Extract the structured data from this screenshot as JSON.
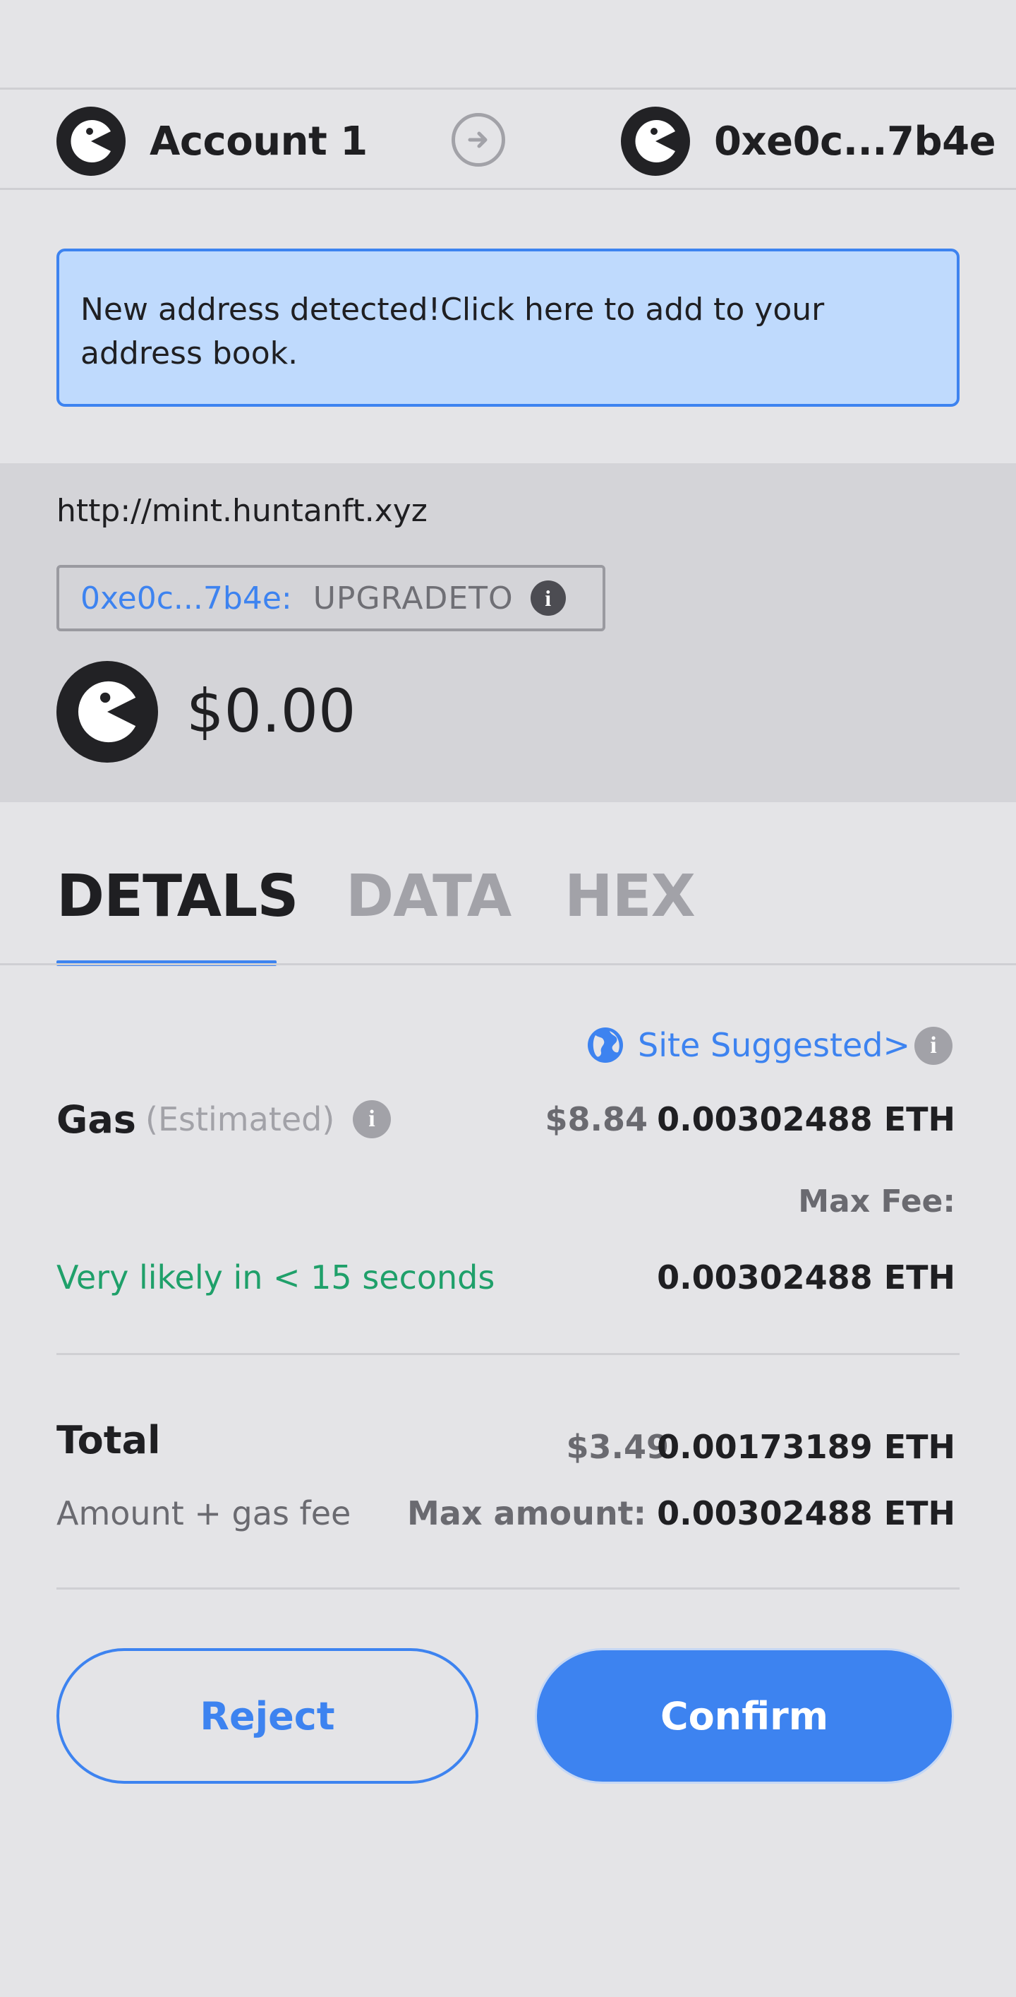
{
  "header": {
    "from_account": "Account 1",
    "to_account": "0xe0c...7b4e"
  },
  "banner": {
    "text": "New address detected!Click here to add to your address book."
  },
  "site": {
    "origin": "http://mint.huntanft.xyz",
    "method_address": "0xe0c...7b4e:",
    "method_name": "UPGRADETO",
    "amount": "$0.00"
  },
  "tabs": [
    {
      "label": "DETALS",
      "active": true
    },
    {
      "label": "DATA",
      "active": false
    },
    {
      "label": "HEX",
      "active": false
    }
  ],
  "gas": {
    "site_suggested": "Site Suggested>",
    "label": "Gas",
    "estimated": "(Estimated)",
    "fiat": "$8.84",
    "eth": "0.00302488 ETH",
    "max_fee_label": "Max Fee:",
    "max_fee_eth": "0.00302488 ETH",
    "likely": "Very likely in < 15 seconds"
  },
  "total": {
    "label": "Total",
    "sublabel": "Amount + gas fee",
    "fiat": "$3.49",
    "eth": "0.00173189 ETH",
    "max_amount_label": "Max amount:",
    "max_amount_eth": "0.00302488 ETH"
  },
  "buttons": {
    "reject": "Reject",
    "confirm": "Confirm"
  },
  "colors": {
    "accent": "#3d83f0",
    "success": "#1fa06a",
    "background": "#e4e4e7",
    "banner_bg": "#bfdafd"
  },
  "icons": [
    "account-avatar-icon",
    "arrow-right-circle-icon",
    "info-icon",
    "globe-icon"
  ]
}
